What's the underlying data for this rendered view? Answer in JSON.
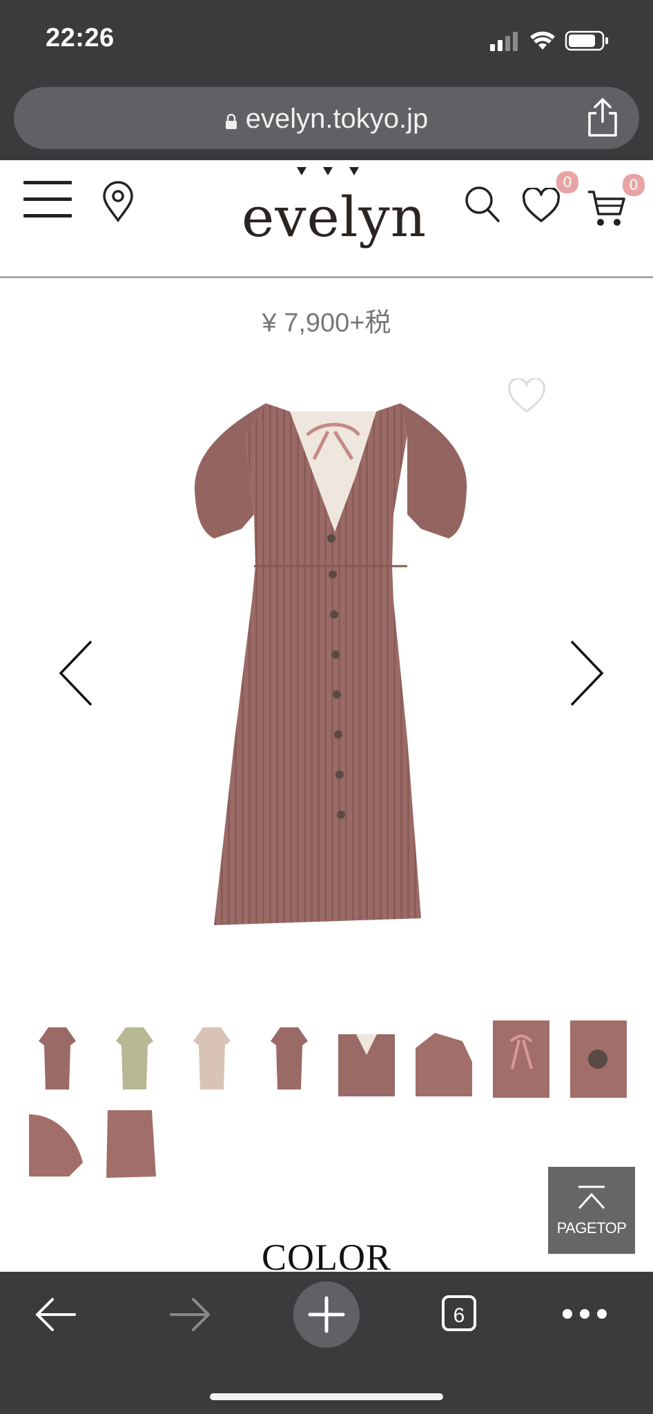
{
  "status_bar": {
    "time": "22:26"
  },
  "browser": {
    "url": "evelyn.tokyo.jp",
    "tab_count": "6"
  },
  "header": {
    "logo": "evelyn",
    "favorites_count": "0",
    "cart_count": "0"
  },
  "product": {
    "price": "¥ 7,900+税",
    "image_alt": "dress-main-image",
    "color_hex": "#9a6a66"
  },
  "thumbnails": [
    {
      "name": "thumb-front-mauve",
      "color": "#9a6a66"
    },
    {
      "name": "thumb-front-sage",
      "color": "#b7b894"
    },
    {
      "name": "thumb-front-beige",
      "color": "#d9c3b6"
    },
    {
      "name": "thumb-back-mauve",
      "color": "#9a6a66"
    },
    {
      "name": "thumb-back-detail",
      "color": "#9a6a66"
    },
    {
      "name": "thumb-shoulder-detail",
      "color": "#a16e69"
    },
    {
      "name": "thumb-ribbon-detail",
      "color": "#a16e69"
    },
    {
      "name": "thumb-button-detail",
      "color": "#a16e69"
    },
    {
      "name": "thumb-sleeve-detail",
      "color": "#a16e69"
    },
    {
      "name": "thumb-hem-detail",
      "color": "#a16e69"
    }
  ],
  "pagetop": {
    "label": "PAGETOP"
  },
  "section": {
    "color_heading": "COLOR"
  }
}
